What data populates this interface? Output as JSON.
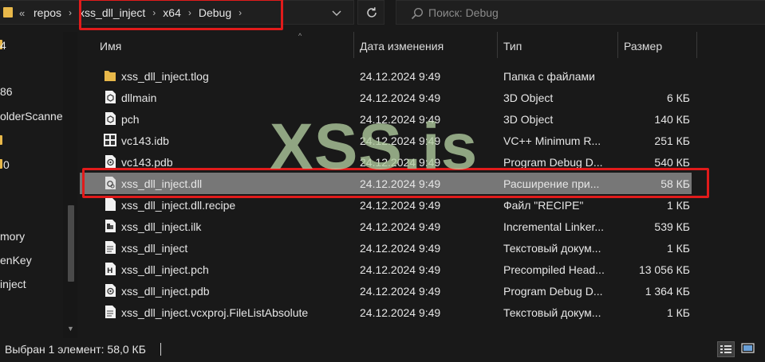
{
  "address_bar": {
    "overflow": "«",
    "crumbs": [
      "repos",
      "xss_dll_inject",
      "x64",
      "Debug"
    ]
  },
  "search": {
    "placeholder": "Поиск: Debug"
  },
  "nav_pane": {
    "items": [
      {
        "label": "4",
        "icon": "folder-icon"
      },
      {
        "label": "86",
        "icon": ""
      },
      {
        "label": "olderScanner",
        "icon": ""
      },
      {
        "label": "",
        "icon": "folder-icon"
      },
      {
        "label": "0",
        "icon": "folder-icon"
      },
      {
        "label": "mory",
        "icon": ""
      },
      {
        "label": "enKey",
        "icon": ""
      },
      {
        "label": "inject",
        "icon": ""
      }
    ]
  },
  "columns": {
    "name": "Имя",
    "date": "Дата изменения",
    "type": "Тип",
    "size": "Размер"
  },
  "files": [
    {
      "name": "xss_dll_inject.tlog",
      "date": "24.12.2024 9:49",
      "type": "Папка с файлами",
      "size": "",
      "icon": "folder-icon"
    },
    {
      "name": "dllmain",
      "date": "24.12.2024 9:49",
      "type": "3D Object",
      "size": "6 КБ",
      "icon": "3d-object-icon"
    },
    {
      "name": "pch",
      "date": "24.12.2024 9:49",
      "type": "3D Object",
      "size": "140 КБ",
      "icon": "3d-object-icon"
    },
    {
      "name": "vc143.idb",
      "date": "24.12.2024 9:49",
      "type": "VC++ Minimum R...",
      "size": "251 КБ",
      "icon": "idb-file-icon"
    },
    {
      "name": "vc143.pdb",
      "date": "24.12.2024 9:49",
      "type": "Program Debug D...",
      "size": "540 КБ",
      "icon": "pdb-file-icon"
    },
    {
      "name": "xss_dll_inject.dll",
      "date": "24.12.2024 9:49",
      "type": "Расширение при...",
      "size": "58 КБ",
      "icon": "dll-file-icon",
      "selected": true
    },
    {
      "name": "xss_dll_inject.dll.recipe",
      "date": "24.12.2024 9:49",
      "type": "Файл \"RECIPE\"",
      "size": "1 КБ",
      "icon": "blank-file-icon"
    },
    {
      "name": "xss_dll_inject.ilk",
      "date": "24.12.2024 9:49",
      "type": "Incremental Linker...",
      "size": "539 КБ",
      "icon": "ilk-file-icon"
    },
    {
      "name": "xss_dll_inject",
      "date": "24.12.2024 9:49",
      "type": "Текстовый докум...",
      "size": "1 КБ",
      "icon": "text-file-icon"
    },
    {
      "name": "xss_dll_inject.pch",
      "date": "24.12.2024 9:49",
      "type": "Precompiled Head...",
      "size": "13 056 КБ",
      "icon": "pch-file-icon"
    },
    {
      "name": "xss_dll_inject.pdb",
      "date": "24.12.2024 9:49",
      "type": "Program Debug D...",
      "size": "1 364 КБ",
      "icon": "pdb-file-icon"
    },
    {
      "name": "xss_dll_inject.vcxproj.FileListAbsolute",
      "date": "24.12.2024 9:49",
      "type": "Текстовый докум...",
      "size": "1 КБ",
      "icon": "text-file-icon"
    }
  ],
  "watermark": "XSS.is",
  "status_bar": {
    "selection": "Выбран 1 элемент: 58,0 КБ"
  },
  "colors": {
    "background": "#191919",
    "selected_row": "#777777",
    "highlight": "#e11b1b",
    "folder": "#e8b84a",
    "watermark": "#b2cda0"
  }
}
